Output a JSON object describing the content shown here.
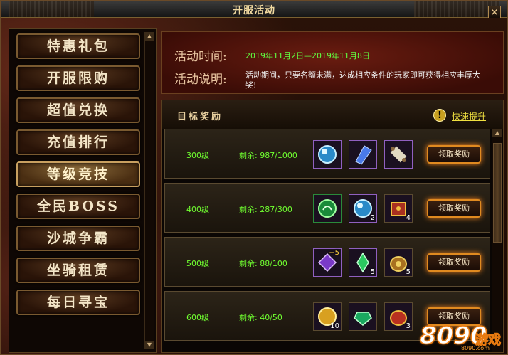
{
  "window": {
    "title": "开服活动",
    "close_label": "✕"
  },
  "menu": {
    "items": [
      {
        "label": "特惠礼包"
      },
      {
        "label": "开服限购"
      },
      {
        "label": "超值兑换"
      },
      {
        "label": "充值排行"
      },
      {
        "label": "等级竞技",
        "active": true
      },
      {
        "label": "全民BOSS"
      },
      {
        "label": "沙城争霸"
      },
      {
        "label": "坐骑租赁"
      },
      {
        "label": "每日寻宝"
      }
    ]
  },
  "info": {
    "time_label": "活动时间:",
    "time_value": "2019年11月2日—2019年11月8日",
    "desc_label": "活动说明:",
    "desc_value": "活动期间，只要名额未满，达成相应条件的玩家即可获得相应丰厚大奖!"
  },
  "rewards": {
    "header": "目标奖励",
    "quick_up": "快速提升",
    "claim_label": "领取奖励",
    "rows": [
      {
        "level": "300级",
        "remain": "剩余: 987/1000",
        "items": [
          {
            "icon": "orb-icon",
            "count": ""
          },
          {
            "icon": "crystal-icon",
            "count": ""
          },
          {
            "icon": "scroll-icon",
            "count": ""
          }
        ]
      },
      {
        "level": "400级",
        "remain": "剩余: 287/300",
        "items": [
          {
            "icon": "green-orb-icon",
            "count": ""
          },
          {
            "icon": "orb-icon",
            "count": "2"
          },
          {
            "icon": "chest-icon",
            "count": "4"
          }
        ]
      },
      {
        "level": "500级",
        "remain": "剩余: 88/100",
        "items": [
          {
            "icon": "purple-gem-icon",
            "count": "",
            "badge": "+5"
          },
          {
            "icon": "green-crystal-icon",
            "count": "5"
          },
          {
            "icon": "gold-bag-icon",
            "count": "5"
          }
        ]
      },
      {
        "level": "600级",
        "remain": "剩余: 40/50",
        "items": [
          {
            "icon": "gold-orb-icon",
            "count": "10"
          },
          {
            "icon": "emerald-icon",
            "count": ""
          },
          {
            "icon": "red-bag-icon",
            "count": "3"
          }
        ]
      }
    ]
  },
  "watermark": {
    "number": "8090",
    "text": "游戏",
    "domain": "8090.com"
  }
}
